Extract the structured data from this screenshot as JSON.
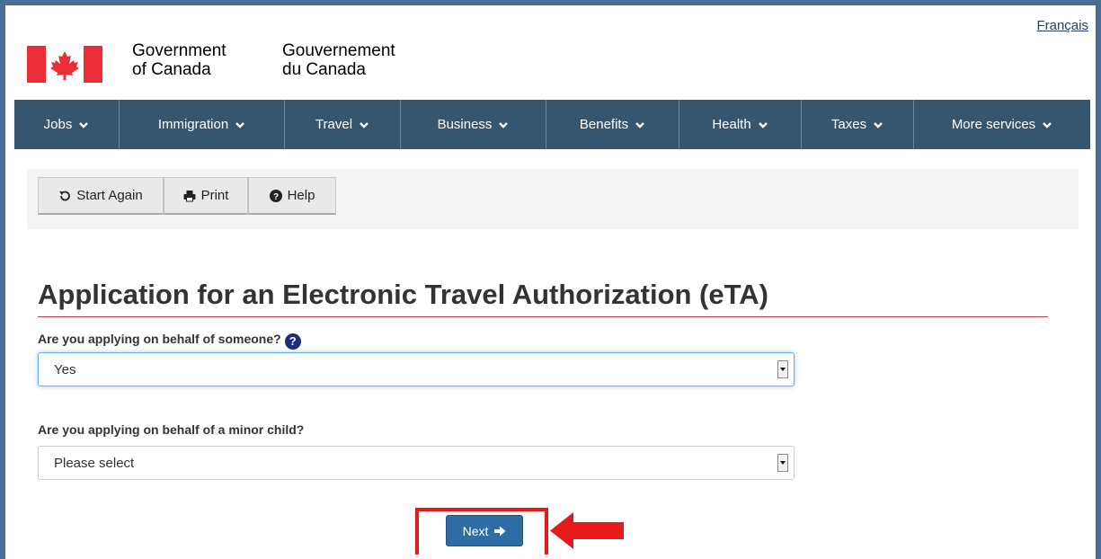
{
  "header": {
    "language_link": "Français",
    "gov_en_line1": "Government",
    "gov_en_line2": "of Canada",
    "gov_fr_line1": "Gouvernement",
    "gov_fr_line2": "du Canada"
  },
  "nav": {
    "items": [
      {
        "label": "Jobs"
      },
      {
        "label": "Immigration"
      },
      {
        "label": "Travel"
      },
      {
        "label": "Business"
      },
      {
        "label": "Benefits"
      },
      {
        "label": "Health"
      },
      {
        "label": "Taxes"
      },
      {
        "label": "More services"
      }
    ]
  },
  "toolbar": {
    "start_again": "Start Again",
    "print": "Print",
    "help": "Help"
  },
  "page": {
    "title": "Application for an Electronic Travel Authorization (eTA)"
  },
  "form": {
    "q1_label": "Are you applying on behalf of someone?",
    "q1_value": "Yes",
    "q2_label": "Are you applying on behalf of a minor child?",
    "q2_value": "Please select"
  },
  "actions": {
    "next_label": "Next"
  },
  "colors": {
    "nav_bg": "#36566f",
    "flag_red": "#eb2d37",
    "primary_button": "#2e6da4",
    "highlight_red": "#e51b1b",
    "title_rule": "#af3c43"
  }
}
